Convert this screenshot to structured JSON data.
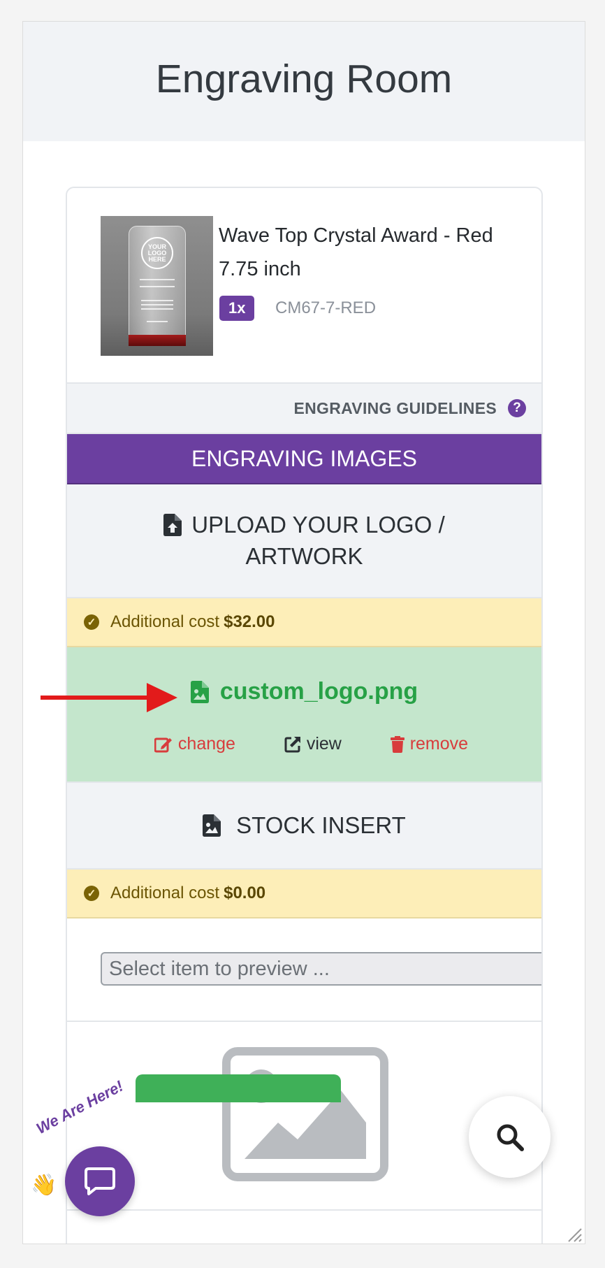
{
  "header": {
    "title": "Engraving Room"
  },
  "product": {
    "title": "Wave Top Crystal Award - Red 7.75 inch",
    "quantity": "1x",
    "sku": "CM67-7-RED",
    "thumb_seal_text": "YOUR LOGO HERE"
  },
  "guidelines": {
    "label": "ENGRAVING GUIDELINES",
    "help_glyph": "?"
  },
  "images_band": {
    "label": "ENGRAVING IMAGES"
  },
  "upload": {
    "label": "UPLOAD YOUR LOGO / ARTWORK",
    "icon": "file-upload-icon"
  },
  "upload_cost": {
    "label": "Additional cost",
    "amount": "$32.00"
  },
  "uploaded_file": {
    "name": "custom_logo.png",
    "actions": {
      "change": "change",
      "view": "view",
      "remove": "remove"
    }
  },
  "stock": {
    "label": "STOCK INSERT",
    "icon": "file-image-icon"
  },
  "stock_cost": {
    "label": "Additional cost",
    "amount": "$0.00"
  },
  "stock_select": {
    "placeholder": "Select item to preview ..."
  },
  "chat_widget": {
    "text": "We Are Here!",
    "hand": "👋"
  },
  "colors": {
    "brand_purple": "#6b3fa0",
    "success_green": "#27a146",
    "danger_red": "#d83c3c",
    "cost_yellow": "#fdeeb8",
    "file_bg_green": "#c4e6cc"
  }
}
